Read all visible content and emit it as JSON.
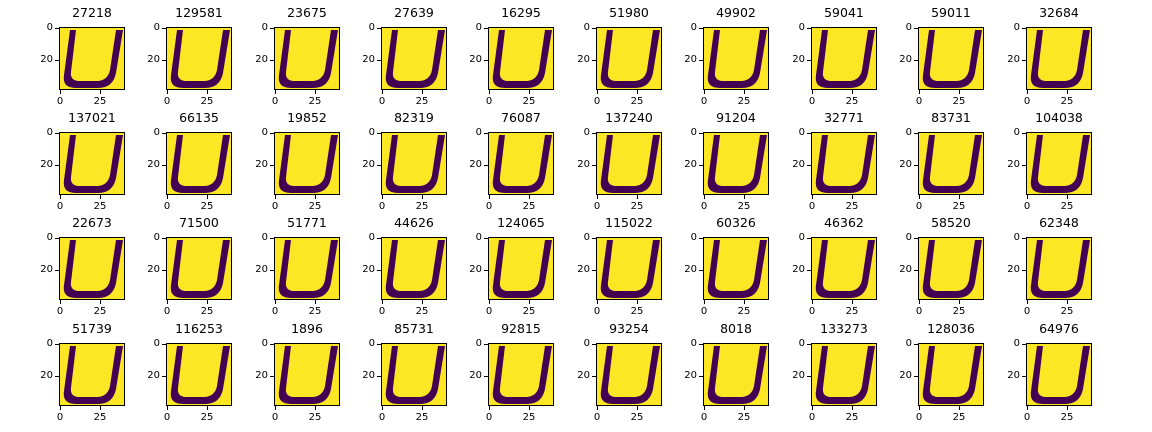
{
  "figure": {
    "colors": {
      "foreground": "#fde725",
      "background": "#440154"
    },
    "y_tick_labels": [
      "0",
      "20"
    ],
    "x_tick_labels": [
      "0",
      "25"
    ],
    "panels": [
      {
        "title": "27218"
      },
      {
        "title": "129581"
      },
      {
        "title": "23675"
      },
      {
        "title": "27639"
      },
      {
        "title": "16295"
      },
      {
        "title": "51980"
      },
      {
        "title": "49902"
      },
      {
        "title": "59041"
      },
      {
        "title": "59011"
      },
      {
        "title": "32684"
      },
      {
        "title": "137021"
      },
      {
        "title": "66135"
      },
      {
        "title": "19852"
      },
      {
        "title": "82319"
      },
      {
        "title": "76087"
      },
      {
        "title": "137240"
      },
      {
        "title": "91204"
      },
      {
        "title": "32771"
      },
      {
        "title": "83731"
      },
      {
        "title": "104038"
      },
      {
        "title": "22673"
      },
      {
        "title": "71500"
      },
      {
        "title": "51771"
      },
      {
        "title": "44626"
      },
      {
        "title": "124065"
      },
      {
        "title": "115022"
      },
      {
        "title": "60326"
      },
      {
        "title": "46362"
      },
      {
        "title": "58520"
      },
      {
        "title": "62348"
      },
      {
        "title": "51739"
      },
      {
        "title": "116253"
      },
      {
        "title": "1896"
      },
      {
        "title": "85731"
      },
      {
        "title": "92815"
      },
      {
        "title": "93254"
      },
      {
        "title": "8018"
      },
      {
        "title": "133273"
      },
      {
        "title": "128036"
      },
      {
        "title": "64976"
      }
    ]
  }
}
